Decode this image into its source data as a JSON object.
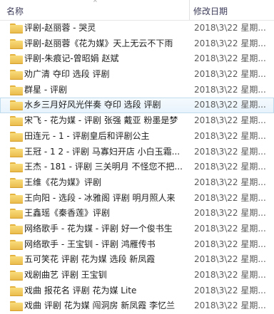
{
  "header": {
    "name_col": "名称",
    "date_col": "修改日期",
    "sort_indicator": "^"
  },
  "rows": [
    {
      "name": "评剧-赵丽蓉 - 哭灵",
      "date": "2018\\3\\22 星期..."
    },
    {
      "name": "评剧-赵丽蓉《花为媒》天上无云不下雨",
      "date": "2018\\3\\22 星期..."
    },
    {
      "name": "评剧-朱痕记-曾昭娟 赵斌",
      "date": "2018\\3\\22 星期..."
    },
    {
      "name": "劝广清 夺印 选段 评剧",
      "date": "2018\\3\\22 星期..."
    },
    {
      "name": "群星 - 评剧",
      "date": "2018\\3\\22 星期..."
    },
    {
      "name": "水乡三月好风光伴奏 夺印 选段 评剧",
      "date": "2018\\3\\22 星期..."
    },
    {
      "name": "宋飞 - 花为媒 - 评剧 张强 戴亚 粉墨是梦",
      "date": "2018\\3\\22 星期..."
    },
    {
      "name": "田连元 - 1 - 评剧皇后和评剧公主",
      "date": "2018\\3\\22 星期..."
    },
    {
      "name": "王冠 - 1 2 - 评剧 马寡妇开店 小白玉霜...",
      "date": "2018\\3\\22 星期..."
    },
    {
      "name": "王杰 - 181 - 评剧 三关明月 不怪您不把...",
      "date": "2018\\3\\22 星期..."
    },
    {
      "name": "王维《花为媒》评剧",
      "date": "2018\\3\\22 星期..."
    },
    {
      "name": "王向阳 - 选段 - 冰雅阁 评剧 明月照人来",
      "date": "2018\\3\\22 星期..."
    },
    {
      "name": "王鑫瑶《秦香莲》评剧",
      "date": "2018\\3\\22 星期..."
    },
    {
      "name": "网络歌手 - 花为媒 - 评剧 好一个俊书生",
      "date": "2018\\3\\22 星期..."
    },
    {
      "name": "网络歌手 - 王宝钏 - 评剧 鸿雁传书",
      "date": "2018\\3\\22 星期..."
    },
    {
      "name": "五可笑花 评剧 花为媒 选段 新凤霞",
      "date": "2018\\3\\22 星期..."
    },
    {
      "name": "戏剧曲艺 评剧 王宝钏",
      "date": "2018\\3\\22 星期..."
    },
    {
      "name": "戏曲 报花名 评剧 花为媒 Lite",
      "date": "2018\\3\\22 星期..."
    },
    {
      "name": "戏曲 评剧 花为媒 闯洞房 新凤霞 李忆兰",
      "date": "2018\\3\\22 星期..."
    }
  ],
  "selected_index": 5,
  "colors": {
    "folder": "#e9b948",
    "selection": "#e6f2fb",
    "selection_border": "#bfdcef",
    "header_text": "#3c3c5a"
  }
}
